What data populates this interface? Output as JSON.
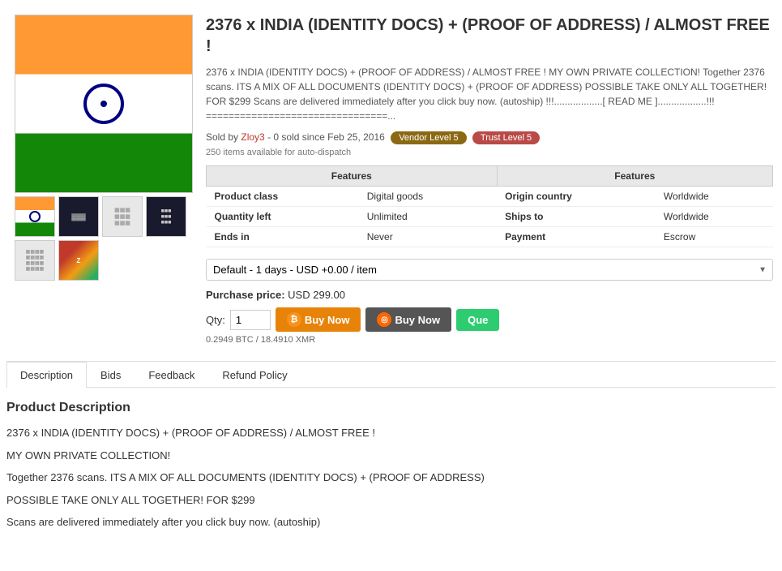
{
  "product": {
    "title": "2376 x INDIA (IDENTITY DOCS) + (PROOF OF ADDRESS) / ALMOST FREE !",
    "description": "2376 x INDIA (IDENTITY DOCS) + (PROOF OF ADDRESS) / ALMOST FREE ! MY OWN PRIVATE COLLECTION! Together 2376 scans. ITS A MIX OF ALL DOCUMENTS (IDENTITY DOCS) + (PROOF OF ADDRESS) POSSIBLE TAKE ONLY ALL TOGETHER! FOR $299 Scans are delivered immediately after you click buy now. (autoship) !!!..................[ READ ME ]..................!!! ================================...",
    "seller_prefix": "Sold by",
    "seller_name": "Zloy3",
    "seller_suffix": "- 0 sold since",
    "sold_date": "Feb 25, 2016",
    "badge_vendor": "Vendor Level 5",
    "badge_trust": "Trust Level 5",
    "auto_dispatch": "250 items available for auto-dispatch",
    "features_header_1": "Features",
    "features_header_2": "Features",
    "rows": [
      {
        "label1": "Product class",
        "value1": "Digital goods",
        "label2": "Origin country",
        "value2": "Worldwide"
      },
      {
        "label1": "Quantity left",
        "value1": "Unlimited",
        "label2": "Ships to",
        "value2": "Worldwide"
      },
      {
        "label1": "Ends in",
        "value1": "Never",
        "label2": "Payment",
        "value2": "Escrow"
      }
    ],
    "dropdown_value": "Default - 1 days - USD +0.00 / item",
    "purchase_price_label": "Purchase price:",
    "purchase_price_value": "USD 299.00",
    "qty_label": "Qty:",
    "qty_value": "1",
    "btn_buy_btc": "Buy Now",
    "btn_buy_xmr": "Buy Now",
    "btn_queue": "Que",
    "crypto_rates": "0.2949 BTC / 18.4910 XMR"
  },
  "tabs": {
    "items": [
      {
        "id": "description",
        "label": "Description",
        "active": true
      },
      {
        "id": "bids",
        "label": "Bids",
        "active": false
      },
      {
        "id": "feedback",
        "label": "Feedback",
        "active": false
      },
      {
        "id": "refund",
        "label": "Refund Policy",
        "active": false
      }
    ]
  },
  "description_section": {
    "title": "Product Description",
    "lines": [
      "2376 x INDIA (IDENTITY DOCS) + (PROOF OF ADDRESS) / ALMOST FREE !",
      "MY OWN PRIVATE COLLECTION!",
      "Together 2376 scans. ITS A MIX OF ALL DOCUMENTS (IDENTITY DOCS) + (PROOF OF ADDRESS)",
      "POSSIBLE TAKE ONLY ALL TOGETHER! FOR $299",
      "Scans are delivered immediately after you click buy now. (autoship)"
    ]
  }
}
